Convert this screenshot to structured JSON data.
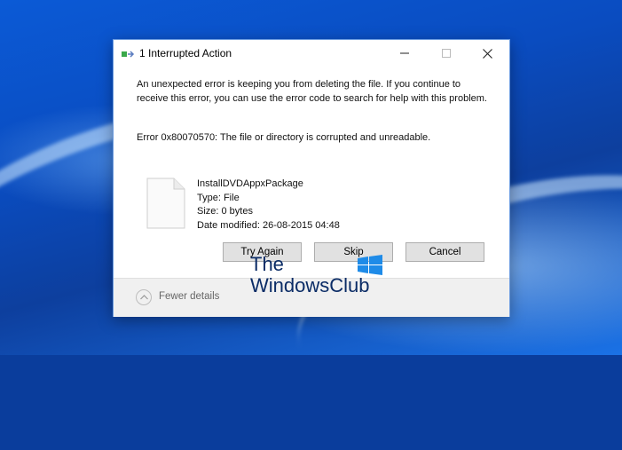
{
  "dialog": {
    "title": "1 Interrupted Action",
    "message": "An unexpected error is keeping you from deleting the file. If you continue to receive this error, you can use the error code to search for help with this problem.",
    "error": "Error 0x80070570: The file or directory is corrupted and unreadable.",
    "file": {
      "name": "InstallDVDAppxPackage",
      "type": "Type: File",
      "size": "Size: 0 bytes",
      "modified": "Date modified: 26-08-2015 04:48"
    },
    "buttons": {
      "try_again": "Try Again",
      "skip": "Skip",
      "cancel": "Cancel"
    },
    "footer": {
      "fewer_details": "Fewer details"
    },
    "icons": {
      "title": "copy-action-icon",
      "minimize": "minimize-icon",
      "maximize": "maximize-icon",
      "close": "close-icon",
      "file": "blank-file-icon",
      "toggle": "chevron-up-icon"
    }
  },
  "watermark": {
    "line1": "The",
    "line2": "WindowsClub"
  },
  "colors": {
    "accent": "#0b5ad6",
    "button": "#e1e1e1",
    "footer": "#f0f0f0"
  }
}
